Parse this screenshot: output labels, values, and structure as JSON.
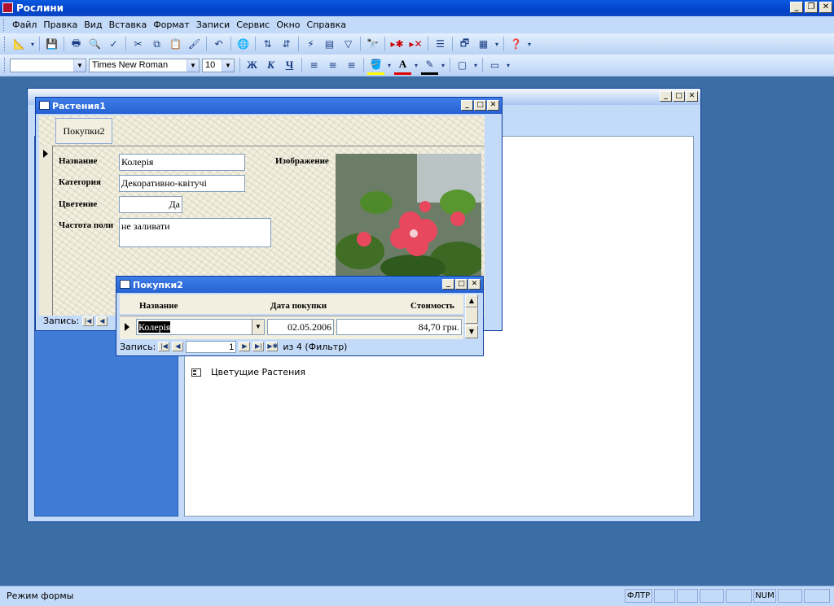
{
  "app": {
    "title": "Рослини"
  },
  "menu": [
    "Файл",
    "Правка",
    "Вид",
    "Вставка",
    "Формат",
    "Записи",
    "Сервис",
    "Окно",
    "Справка"
  ],
  "format_toolbar": {
    "object_value": "",
    "font_value": "Times New Roman",
    "size_value": "10",
    "bold_glyph": "Ж",
    "italic_glyph": "К",
    "underline_glyph": "Ч"
  },
  "db_window": {
    "items": [
      {
        "label": "Цветущие Растения",
        "icon": "form-icon"
      }
    ]
  },
  "form": {
    "title": "Растения1",
    "tab_label": "Покупки2",
    "labels": {
      "name": "Название",
      "category": "Категория",
      "blooming": "Цветение",
      "frequency": "Частота поли",
      "image": "Изображение"
    },
    "values": {
      "name": "Колерія",
      "category": "Декоративно-квітучі",
      "blooming": "Да",
      "frequency": "не заливати"
    },
    "nav_label": "Запись:"
  },
  "subform": {
    "title": "Покупки2",
    "columns": [
      "Название",
      "Дата покупки",
      "Стоимость"
    ],
    "row": {
      "name": "Колерія",
      "date": "02.05.2006",
      "cost": "84,70 грн."
    },
    "nav": {
      "label": "Запись:",
      "current": "1",
      "total_text": "из  4 (Фильтр)"
    }
  },
  "status": {
    "text": "Режим формы",
    "filter_indicator": "ФЛТР",
    "num_indicator": "NUM"
  },
  "colors": {
    "desktop": "#3a6ea5",
    "titlebar": "#0a5ae0",
    "toolbar": "#c3daf9"
  }
}
